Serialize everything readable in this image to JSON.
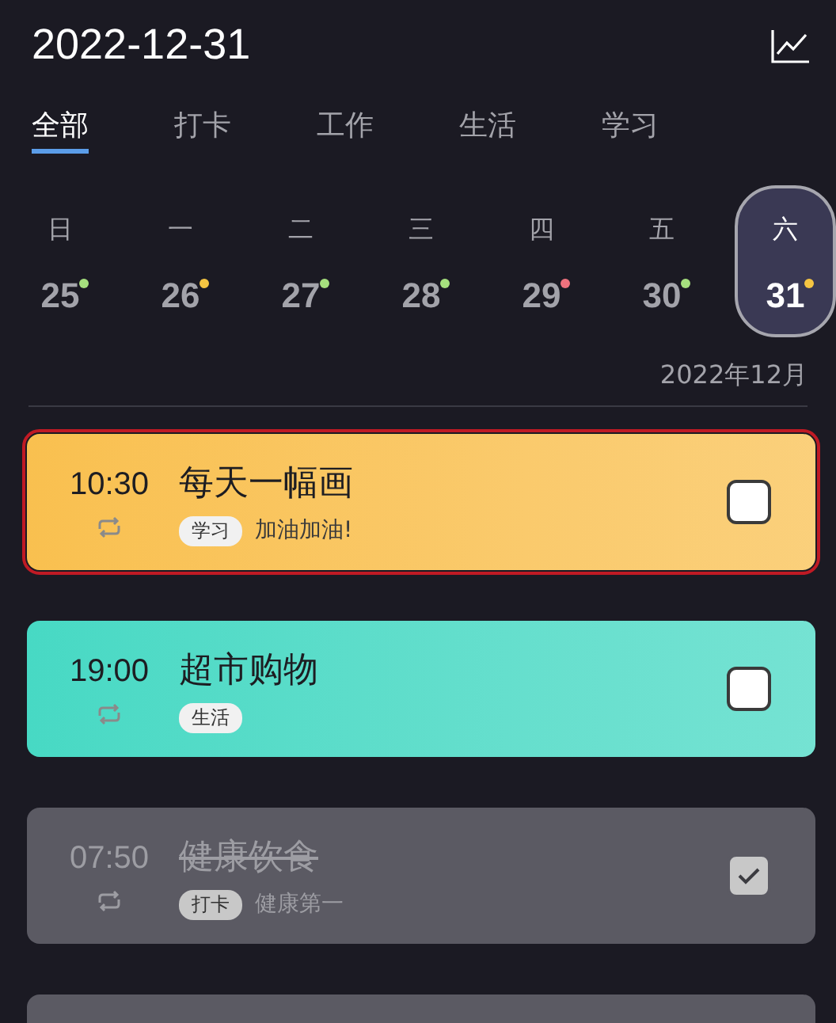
{
  "header": {
    "title": "2022-12-31"
  },
  "tabs": [
    {
      "label": "全部",
      "selected": true
    },
    {
      "label": "打卡",
      "selected": false
    },
    {
      "label": "工作",
      "selected": false
    },
    {
      "label": "生活",
      "selected": false
    },
    {
      "label": "学习",
      "selected": false
    }
  ],
  "week": [
    {
      "weekday": "日",
      "date": "25",
      "color": "#a6e07e",
      "selected": false
    },
    {
      "weekday": "一",
      "date": "26",
      "color": "#f5c542",
      "selected": false
    },
    {
      "weekday": "二",
      "date": "27",
      "color": "#a6e07e",
      "selected": false
    },
    {
      "weekday": "三",
      "date": "28",
      "color": "#a6e07e",
      "selected": false
    },
    {
      "weekday": "四",
      "date": "29",
      "color": "#f0727e",
      "selected": false
    },
    {
      "weekday": "五",
      "date": "30",
      "color": "#a6e07e",
      "selected": false
    },
    {
      "weekday": "六",
      "date": "31",
      "color": "#f5c542",
      "selected": true
    }
  ],
  "month": "2022年12月",
  "tasks": [
    {
      "time": "10:30",
      "title": "每天一幅画",
      "tag": "学习",
      "note": "加油加油!",
      "color": "#f9c04f",
      "done": false,
      "selected": true
    },
    {
      "time": "19:00",
      "title": "超市购物",
      "tag": "生活",
      "color": "#47d9c4",
      "done": false,
      "selected": false
    },
    {
      "time": "07:50",
      "title": "健康饮食",
      "tag": "打卡",
      "note": "健康第一",
      "done": true,
      "selected": false
    },
    {
      "done": true,
      "selected": false
    }
  ]
}
